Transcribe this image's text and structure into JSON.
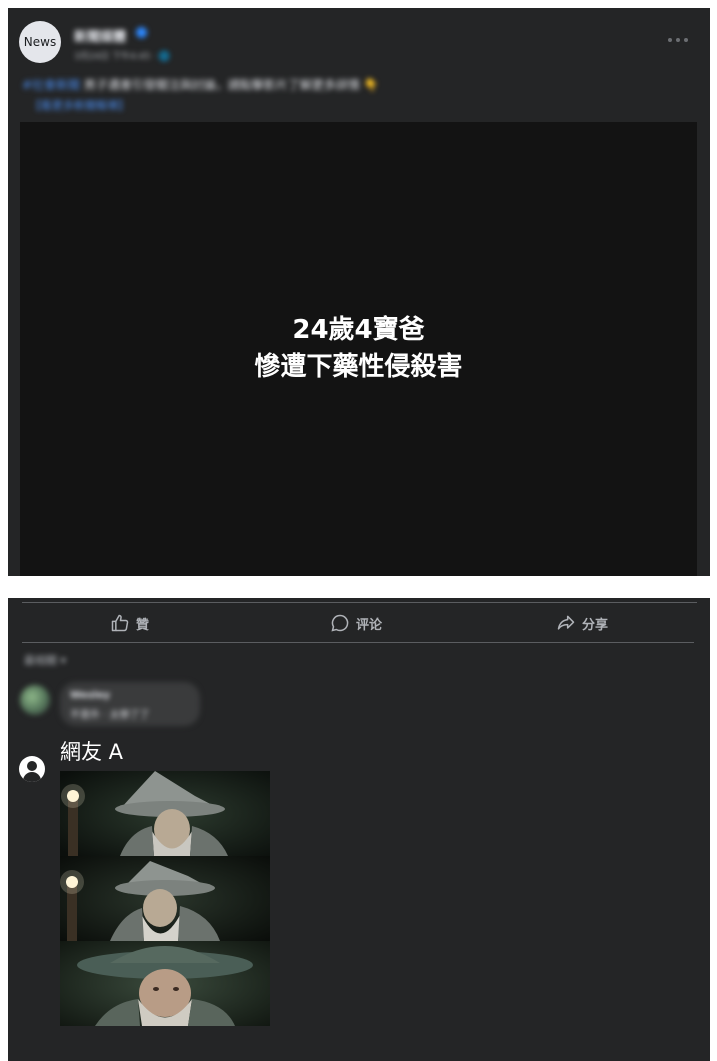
{
  "post": {
    "avatar_text": "News",
    "page_name": "新聞媒體",
    "meta": "3月24日 下午4:45 · 🌐",
    "caption_hashtag": "#社會新聞",
    "caption_text": "男子遇害引發關注與討論，請點擊影片了解更多詳情 👇",
    "caption_link": "【看更多新聞報導】"
  },
  "video": {
    "line1": "24歲4寶爸",
    "line2": "慘遭下藥性侵殺害"
  },
  "actions": {
    "like": "贊",
    "comment": "评论",
    "share": "分享"
  },
  "comments": {
    "sort_label": "最相關 ▾",
    "first": {
      "name": "Wesley",
      "text": "不意外 · 太惨了了"
    },
    "second": {
      "name": "網友 A"
    }
  },
  "colors": {
    "background": "#242526",
    "accent": "#4b8ef1",
    "video": "#131313"
  }
}
